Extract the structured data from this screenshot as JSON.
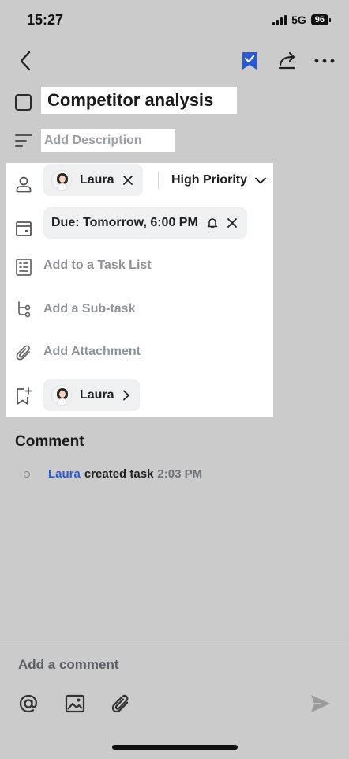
{
  "status_bar": {
    "time": "15:27",
    "network": "5G",
    "battery": "96"
  },
  "colors": {
    "accent": "#2a5bd7",
    "background": "#cbcbcb",
    "panel": "#ffffff"
  },
  "nav": {
    "back_icon": "chevron-left-icon",
    "bookmark_icon": "bookmark-check-icon",
    "share_icon": "share-icon",
    "more_icon": "more-horizontal-icon"
  },
  "task": {
    "title": "Competitor analysis",
    "description_placeholder": "Add Description"
  },
  "details": {
    "assignee": {
      "name": "Laura",
      "remove_icon": "close-icon"
    },
    "priority": {
      "label": "High Priority",
      "dropdown_icon": "chevron-down-icon"
    },
    "due": {
      "label": "Due: Tomorrow, 6:00 PM",
      "reminder_icon": "bell-icon",
      "remove_icon": "close-icon"
    },
    "task_list": {
      "label": "Add to a Task List"
    },
    "subtask": {
      "label": "Add a Sub-task"
    },
    "attachment": {
      "label": "Add Attachment"
    },
    "follower": {
      "name": "Laura",
      "arrow_icon": "chevron-right-icon"
    }
  },
  "comments": {
    "heading": "Comment",
    "activity": [
      {
        "user": "Laura",
        "action": "created task",
        "time": "2:03 PM"
      }
    ]
  },
  "composer": {
    "placeholder": "Add a comment",
    "tools": [
      "at-icon",
      "image-icon",
      "attachment-icon"
    ],
    "send_icon": "send-icon"
  }
}
